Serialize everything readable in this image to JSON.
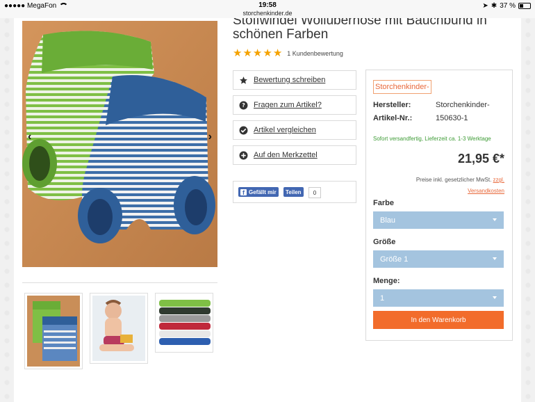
{
  "statusbar": {
    "carrier": "●●●●● MegaFon",
    "time": "19:58",
    "url": "storchenkinder.de",
    "battery": "37 %"
  },
  "product": {
    "title_line1": "Stoffwindel Wollüberhose mit Bauchbund in",
    "title_line2": "schönen Farben",
    "rating_stars": 5,
    "review_count": "1 Kundenbewertung"
  },
  "actions": [
    {
      "label": "Bewertung schreiben",
      "icon": "star-icon"
    },
    {
      "label": "Fragen zum Artikel?",
      "icon": "question-icon"
    },
    {
      "label": "Artikel vergleichen",
      "icon": "check-icon"
    },
    {
      "label": "Auf den Merkzettel",
      "icon": "plus-icon"
    }
  ],
  "social": {
    "like_label": "Gefällt mir",
    "share_label": "Teilen",
    "count": "0"
  },
  "buybox": {
    "brand": "Storchenkinder-",
    "manufacturer_label": "Hersteller:",
    "manufacturer_value": "Storchenkinder-",
    "sku_label": "Artikel-Nr.:",
    "sku_value": "150630-1",
    "shipping": "Sofort versandfertig, Lieferzeit ca. 1-3 Werktage",
    "price": "21,95 €*",
    "vat_text": "Preise inkl. gesetzlicher MwSt.",
    "vat_link1": "zzgl.",
    "vat_link2": "Versandkosten",
    "color_label": "Farbe",
    "color_value": "Blau",
    "size_label": "Größe",
    "size_value": "Größe 1",
    "qty_label": "Menge:",
    "qty_value": "1",
    "cart_label": "In den Warenkorb"
  },
  "colors": {
    "accent": "#f26c2b",
    "select_bg": "#a4c4df",
    "star": "#f5a200",
    "ship_green": "#3d9b35"
  }
}
